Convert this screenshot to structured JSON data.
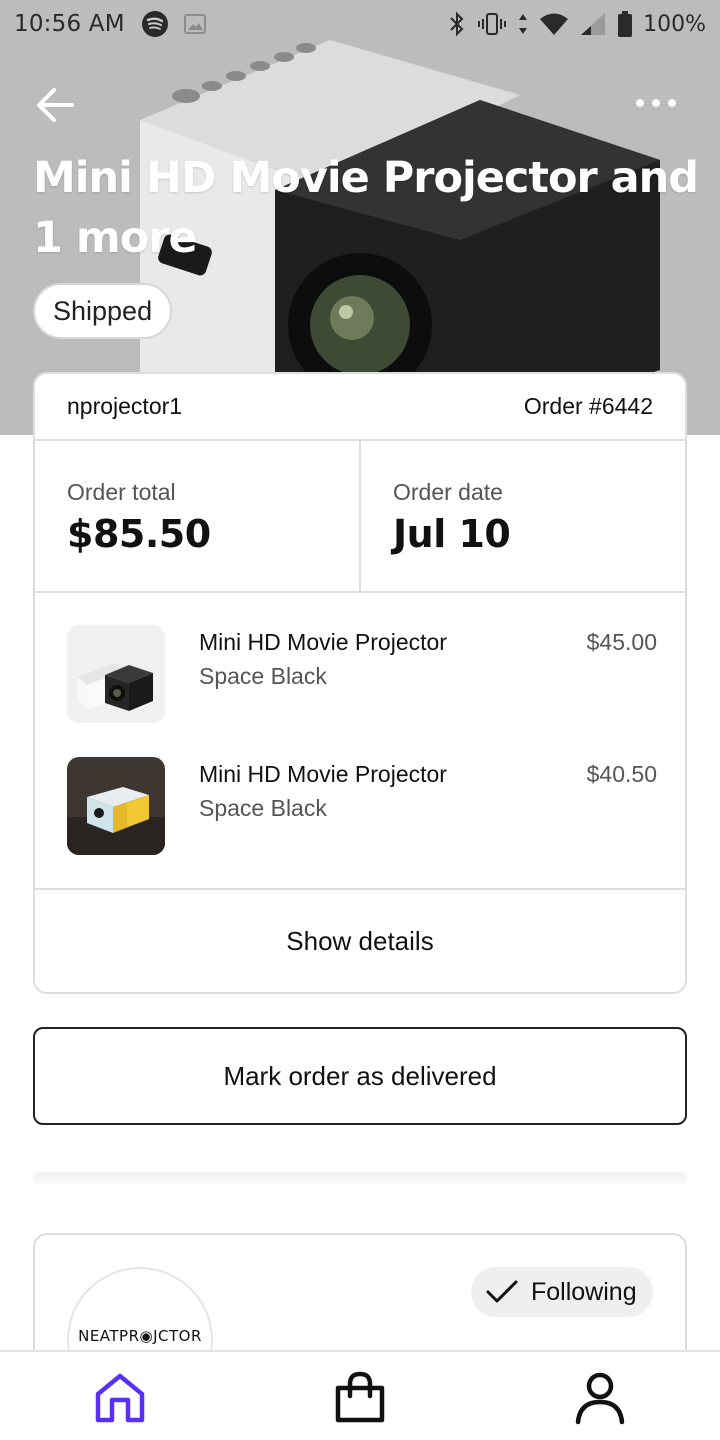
{
  "status_bar": {
    "time": "10:56 AM",
    "battery": "100%"
  },
  "header": {
    "title": "Mini HD Movie Projector and 1 more",
    "status": "Shipped"
  },
  "order": {
    "shop_name": "nprojector1",
    "order_number": "Order #6442",
    "total_label": "Order total",
    "total_value": "$85.50",
    "date_label": "Order date",
    "date_value": "Jul 10",
    "items": [
      {
        "name": "Mini HD Movie Projector",
        "variant": "Space Black",
        "price": "$45.00"
      },
      {
        "name": "Mini HD Movie Projector",
        "variant": "Space Black",
        "price": "$40.50"
      }
    ],
    "show_details_label": "Show details"
  },
  "actions": {
    "mark_delivered_label": "Mark order as delivered"
  },
  "shop": {
    "logo_text": "NEATPR◉JCTOR",
    "follow_label": "Following"
  },
  "nav": {
    "items": [
      "home-icon",
      "bag-icon",
      "profile-icon"
    ],
    "active_color": "#5a31f4"
  }
}
